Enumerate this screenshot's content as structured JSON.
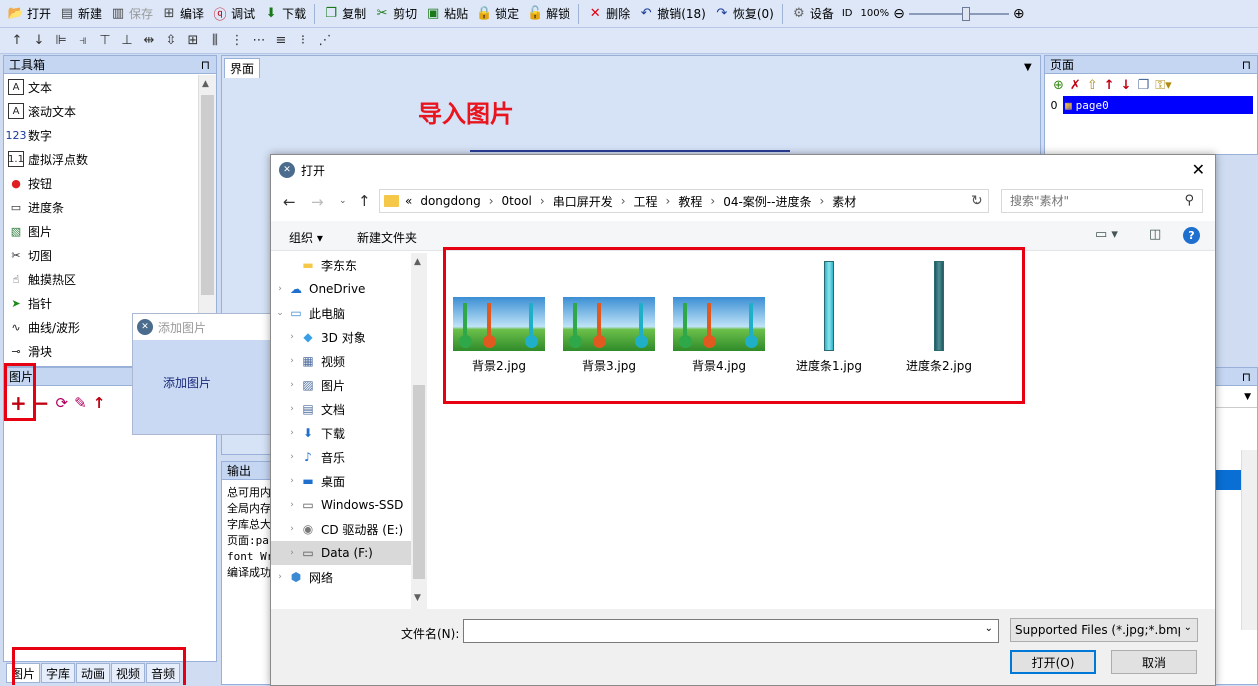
{
  "toolbar": {
    "items": [
      {
        "label": "打开",
        "icon": "folder-open-icon"
      },
      {
        "label": "新建",
        "icon": "new-file-icon"
      },
      {
        "label": "保存",
        "icon": "save-icon"
      },
      {
        "label": "编译",
        "icon": "compile-icon"
      },
      {
        "label": "调试",
        "icon": "debug-icon"
      },
      {
        "label": "下载",
        "icon": "download-icon"
      },
      {
        "label": "复制",
        "icon": "copy-icon"
      },
      {
        "label": "剪切",
        "icon": "cut-icon"
      },
      {
        "label": "粘贴",
        "icon": "paste-icon"
      },
      {
        "label": "锁定",
        "icon": "lock-icon"
      },
      {
        "label": "解锁",
        "icon": "unlock-icon"
      },
      {
        "label": "删除",
        "icon": "delete-icon"
      },
      {
        "label": "撤销(18)",
        "icon": "undo-icon"
      },
      {
        "label": "恢复(0)",
        "icon": "redo-icon"
      },
      {
        "label": "设备",
        "icon": "gear-icon"
      }
    ],
    "id_label": "ID",
    "zoom": "100%"
  },
  "toolbox": {
    "title": "工具箱",
    "items": [
      {
        "label": "文本",
        "icon": "text-icon"
      },
      {
        "label": "滚动文本",
        "icon": "scroll-text-icon"
      },
      {
        "label": "数字",
        "icon": "number-icon"
      },
      {
        "label": "虚拟浮点数",
        "icon": "float-icon"
      },
      {
        "label": "按钮",
        "icon": "button-icon"
      },
      {
        "label": "进度条",
        "icon": "progress-icon"
      },
      {
        "label": "图片",
        "icon": "picture-icon"
      },
      {
        "label": "切图",
        "icon": "crop-icon"
      },
      {
        "label": "触摸热区",
        "icon": "touch-icon"
      },
      {
        "label": "指针",
        "icon": "pointer-icon"
      },
      {
        "label": "曲线/波形",
        "icon": "wave-icon"
      },
      {
        "label": "滑块",
        "icon": "slider-icon"
      }
    ]
  },
  "picture_panel": {
    "title": "图片"
  },
  "bottom_tabs": [
    "图片",
    "字库",
    "动画",
    "视频",
    "音频"
  ],
  "canvas": {
    "tab": "界面",
    "heading": "导入图片"
  },
  "popup": {
    "title": "添加图片",
    "body": "添加图片"
  },
  "output": {
    "tab": "输出",
    "lines": [
      "总可用内",
      "全局内存",
      "字库总大",
      "页面:pa",
      "font Wr",
      "编译成功"
    ]
  },
  "pages": {
    "title": "页面",
    "row_index": "0",
    "row_name": "page0"
  },
  "dialog": {
    "title": "打开",
    "breadcrumb": [
      "«",
      "dongdong",
      "0tool",
      "串口屏开发",
      "工程",
      "教程",
      "04-案例--进度条",
      "素材"
    ],
    "search_placeholder": "搜索\"素材\"",
    "organize": "组织",
    "new_folder": "新建文件夹",
    "tree": [
      {
        "label": "李东东",
        "icon": "folder-icon",
        "level": 1
      },
      {
        "label": "OneDrive",
        "icon": "cloud-icon",
        "level": 0
      },
      {
        "label": "此电脑",
        "icon": "computer-icon",
        "level": 0
      },
      {
        "label": "3D 对象",
        "icon": "cube-icon",
        "level": 1
      },
      {
        "label": "视频",
        "icon": "video-icon",
        "level": 1
      },
      {
        "label": "图片",
        "icon": "image-icon",
        "level": 1
      },
      {
        "label": "文档",
        "icon": "document-icon",
        "level": 1
      },
      {
        "label": "下载",
        "icon": "download-arrow-icon",
        "level": 1
      },
      {
        "label": "音乐",
        "icon": "music-icon",
        "level": 1
      },
      {
        "label": "桌面",
        "icon": "desktop-icon",
        "level": 1
      },
      {
        "label": "Windows-SSD",
        "icon": "drive-icon",
        "level": 1
      },
      {
        "label": "CD 驱动器 (E:)",
        "icon": "cd-icon",
        "level": 1
      },
      {
        "label": "Data (F:)",
        "icon": "drive-icon",
        "level": 1
      },
      {
        "label": "网络",
        "icon": "network-icon",
        "level": 0
      }
    ],
    "files": [
      {
        "name": "背景2.jpg",
        "kind": "thermo"
      },
      {
        "name": "背景3.jpg",
        "kind": "thermo"
      },
      {
        "name": "背景4.jpg",
        "kind": "thermo"
      },
      {
        "name": "进度条1.jpg",
        "kind": "bar-light"
      },
      {
        "name": "进度条2.jpg",
        "kind": "bar-dark"
      }
    ],
    "filename_label": "文件名(N):",
    "filename_value": "",
    "filetype": "Supported Files (*.jpg;*.bmp",
    "open_button": "打开(O)",
    "cancel_button": "取消"
  },
  "colors": {
    "accent_red": "#e60012",
    "selection_blue": "#0000ff",
    "heading_red": "#e8141e"
  }
}
